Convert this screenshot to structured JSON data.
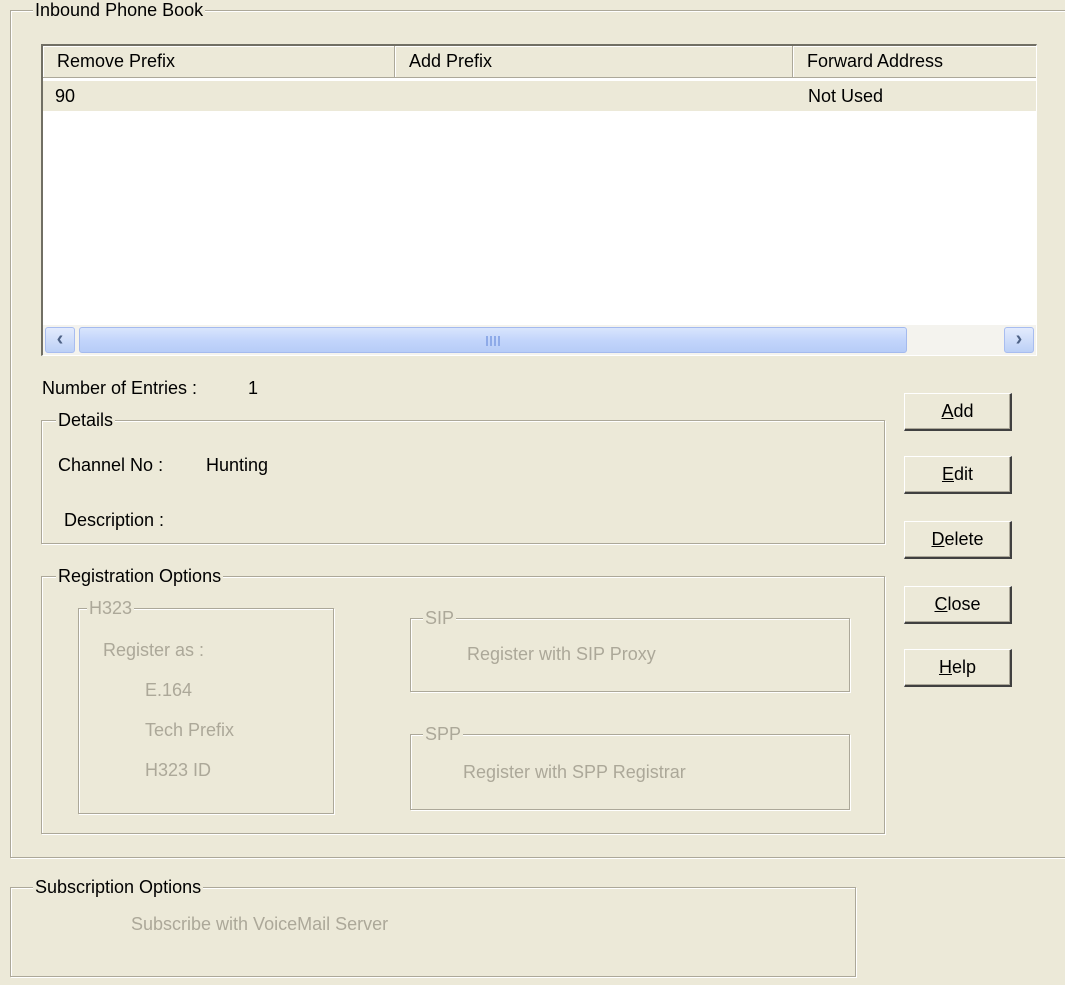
{
  "phonebook": {
    "title": "Inbound  Phone Book",
    "columns": [
      "Remove Prefix",
      "Add Prefix",
      "Forward Address"
    ],
    "rows": [
      {
        "remove_prefix": "90",
        "add_prefix": "",
        "forward_address": "Not Used"
      }
    ],
    "entries_label": "Number of Entries :",
    "entries_count": "1"
  },
  "details": {
    "title": "Details",
    "channel_label": "Channel No :",
    "channel_value": "Hunting",
    "description_label": "Description :",
    "description_value": ""
  },
  "registration": {
    "title": "Registration Options",
    "h323": {
      "title": "H323",
      "register_as": "Register as :",
      "options": [
        "E.164",
        "Tech Prefix",
        "H323 ID"
      ]
    },
    "sip": {
      "title": "SIP",
      "text": "Register with SIP Proxy"
    },
    "spp": {
      "title": "SPP",
      "text": "Register with SPP Registrar"
    }
  },
  "buttons": {
    "add": {
      "mnemonic": "A",
      "rest": "dd"
    },
    "edit": {
      "mnemonic": "E",
      "rest": "dit"
    },
    "delete": {
      "mnemonic": "D",
      "rest": "elete"
    },
    "close": {
      "mnemonic": "C",
      "rest": "lose"
    },
    "help": {
      "mnemonic": "H",
      "rest": "elp"
    }
  },
  "subscription": {
    "title": "Subscription Options",
    "text": "Subscribe with VoiceMail Server"
  },
  "icons": {
    "scroll_left": "chevron-left-icon",
    "scroll_right": "chevron-right-icon"
  },
  "colors": {
    "dialog_bg": "#ECE9D8",
    "disabled_text": "#ACA899",
    "scrollbar_blue": "#C3D5FB"
  }
}
